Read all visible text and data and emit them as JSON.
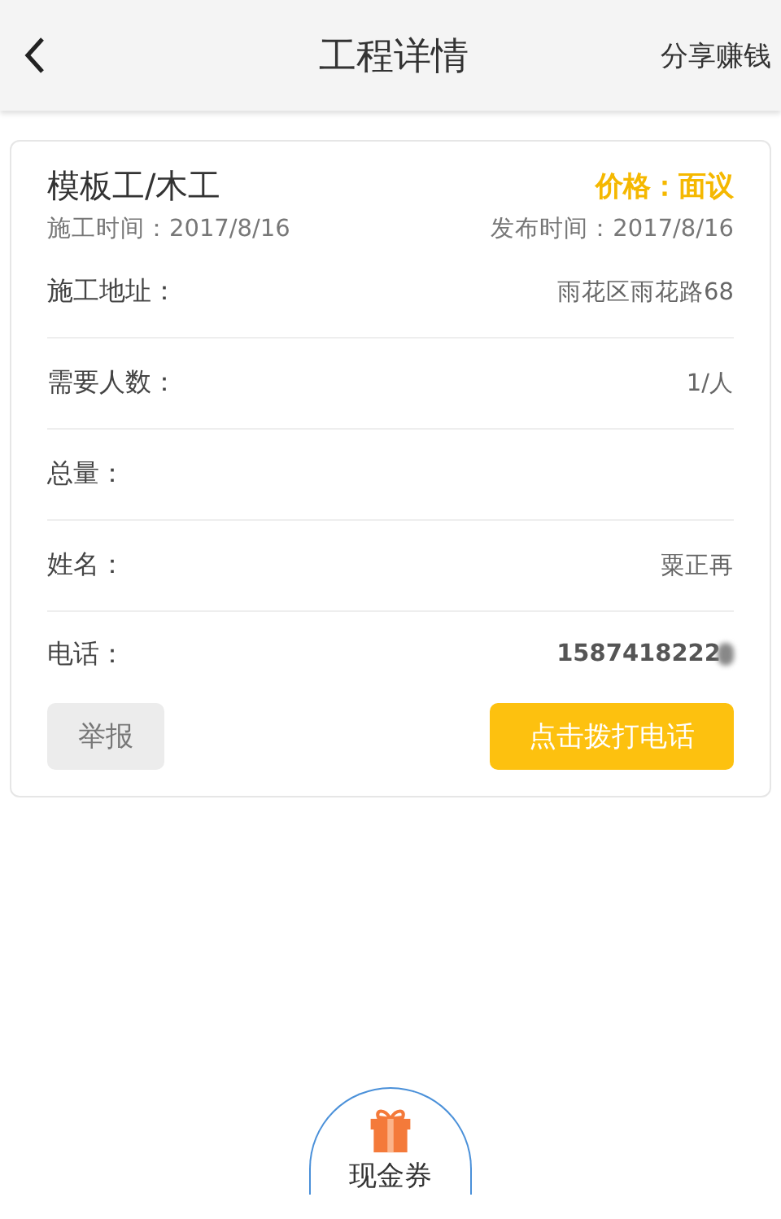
{
  "header": {
    "title": "工程详情",
    "action": "分享赚钱"
  },
  "job": {
    "title": "模板工/木工",
    "price": "价格：面议",
    "work_time": "施工时间：2017/8/16",
    "publish_time": "发布时间：2017/8/16",
    "rows": [
      {
        "kind": "text",
        "label": "施工地址：",
        "value": "雨花区雨花路68"
      },
      {
        "kind": "text",
        "label": "需要人数：",
        "value": "1/人"
      },
      {
        "kind": "text",
        "label": "总量："
      },
      {
        "kind": "text",
        "label": "姓名：",
        "value": "粟正再"
      },
      {
        "kind": "phone",
        "label": "电话：",
        "value": "1587418222"
      }
    ],
    "report_button": "举报",
    "call_button": "点击拨打电话"
  },
  "coupon": {
    "label": "现金券"
  }
}
